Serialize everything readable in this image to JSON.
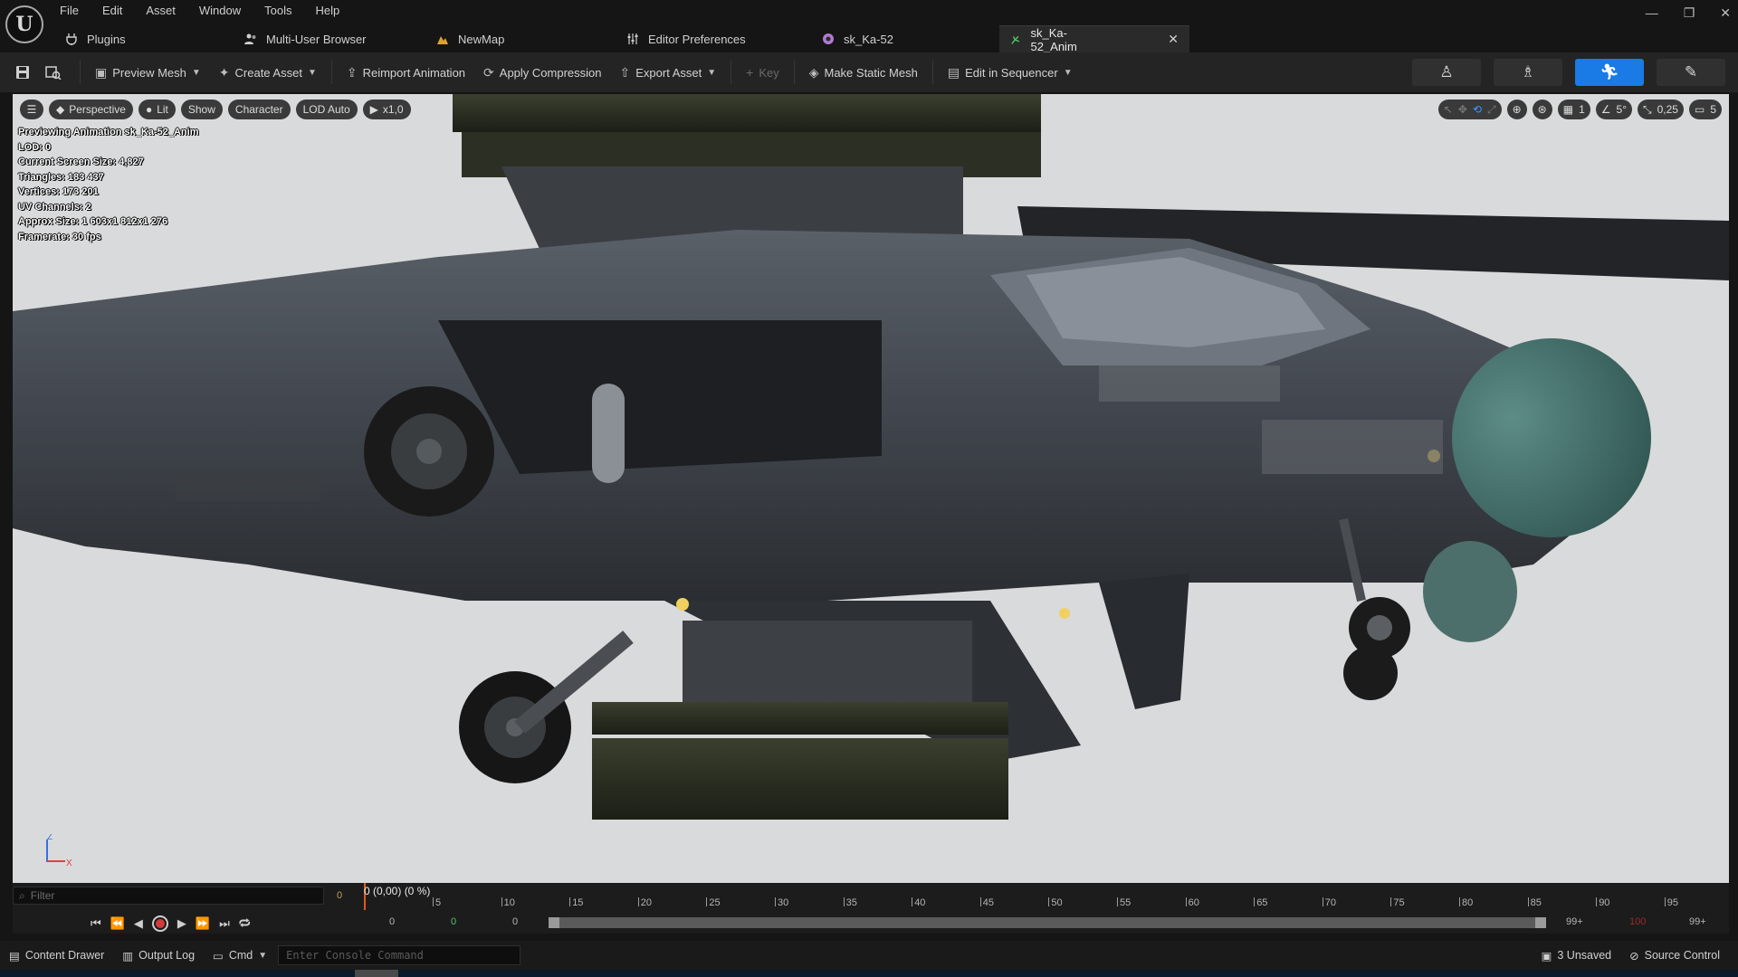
{
  "menu": [
    "File",
    "Edit",
    "Asset",
    "Window",
    "Tools",
    "Help"
  ],
  "window_controls": [
    "—",
    "❐",
    "✕"
  ],
  "tabs": [
    {
      "label": "Plugins",
      "icon": "plug-icon"
    },
    {
      "label": "Multi-User Browser",
      "icon": "users-icon"
    },
    {
      "label": "NewMap",
      "icon": "level-icon"
    },
    {
      "label": "Editor Preferences",
      "icon": "sliders-icon"
    },
    {
      "label": "sk_Ka-52",
      "icon": "skeletal-mesh-icon"
    },
    {
      "label": "sk_Ka-52_Anim",
      "icon": "animation-icon",
      "active": true
    }
  ],
  "toolbar": {
    "preview_mesh": "Preview Mesh",
    "create_asset": "Create Asset",
    "reimport": "Reimport Animation",
    "apply_compression": "Apply Compression",
    "export_asset": "Export Asset",
    "key": "Key",
    "make_static_mesh": "Make Static Mesh",
    "edit_in_sequencer": "Edit in Sequencer"
  },
  "viewport": {
    "perspective": "Perspective",
    "lit": "Lit",
    "show": "Show",
    "character": "Character",
    "lod": "LOD Auto",
    "speed": "x1,0",
    "grid_value": "1",
    "angle_value": "5°",
    "scale_value": "0,25",
    "camera_speed": "5",
    "axis_z": "Z",
    "axis_x": "X"
  },
  "stats": [
    "Previewing Animation sk_Ka-52_Anim",
    "LOD: 0",
    "Current Screen Size: 4,827",
    "Triangles: 183 437",
    "Vertices: 173 201",
    "UV Channels: 2",
    "Approx Size: 1 603x1 812x1 276",
    "Framerate: 30 fps"
  ],
  "timeline": {
    "filter_placeholder": "Filter",
    "zero": "0",
    "playhead": "0 (0,00) (0 %)",
    "ticks": [
      "5",
      "10",
      "15",
      "20",
      "25",
      "30",
      "35",
      "40",
      "45",
      "50",
      "55",
      "60",
      "65",
      "70",
      "75",
      "80",
      "85",
      "90",
      "95"
    ],
    "start_a": "0",
    "start_b": "0",
    "start_c": "0",
    "end_a": "99+",
    "end_b": "100",
    "end_c": "99+"
  },
  "status": {
    "content_drawer": "Content Drawer",
    "output_log": "Output Log",
    "cmd": "Cmd",
    "console_placeholder": "Enter Console Command",
    "unsaved": "3 Unsaved",
    "source_control": "Source Control"
  },
  "colors": {
    "accent": "#1a7ae6",
    "viewport_bg": "#d9dadb",
    "record": "#d43a3a"
  }
}
